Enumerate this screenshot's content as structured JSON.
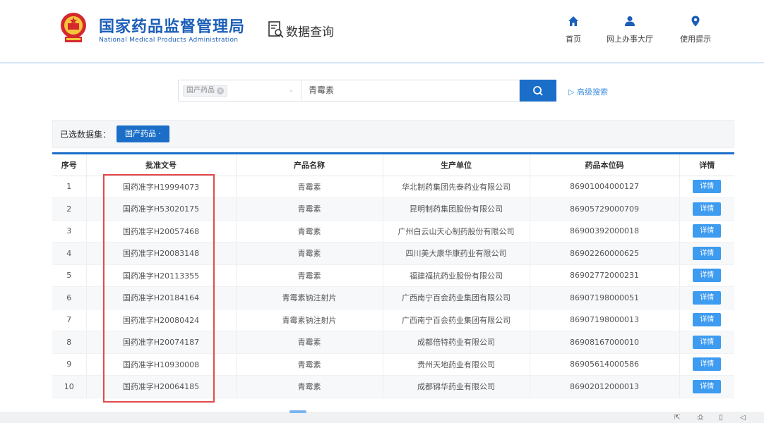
{
  "header": {
    "org_name_cn": "国家药品监督管理局",
    "org_name_en": "National Medical Products Administration",
    "page_title": "数据查询",
    "nav": [
      {
        "label": "首页",
        "icon": "home-icon"
      },
      {
        "label": "网上办事大厅",
        "icon": "user-icon"
      },
      {
        "label": "使用提示",
        "icon": "location-pin-icon"
      }
    ]
  },
  "search": {
    "category_tag": "国产药品",
    "query_value": "青霉素",
    "advanced_label": "高级搜索"
  },
  "filter": {
    "label": "已选数据集：",
    "selected_tag": "国产药品 ·"
  },
  "table": {
    "headers": [
      "序号",
      "批准文号",
      "产品名称",
      "生产单位",
      "药品本位码",
      "详情"
    ],
    "detail_label": "详情",
    "rows": [
      {
        "no": "1",
        "approval": "国药准字H19994073",
        "product": "青霉素",
        "maker": "华北制药集团先泰药业有限公司",
        "code": "86901004000127"
      },
      {
        "no": "2",
        "approval": "国药准字H53020175",
        "product": "青霉素",
        "maker": "昆明制药集团股份有限公司",
        "code": "86905729000709"
      },
      {
        "no": "3",
        "approval": "国药准字H20057468",
        "product": "青霉素",
        "maker": "广州白云山天心制药股份有限公司",
        "code": "86900392000018"
      },
      {
        "no": "4",
        "approval": "国药准字H20083148",
        "product": "青霉素",
        "maker": "四川美大康华康药业有限公司",
        "code": "86902260000625"
      },
      {
        "no": "5",
        "approval": "国药准字H20113355",
        "product": "青霉素",
        "maker": "福建福抗药业股份有限公司",
        "code": "86902772000231"
      },
      {
        "no": "6",
        "approval": "国药准字H20184164",
        "product": "青霉素钠注射片",
        "maker": "广西南宁百会药业集团有限公司",
        "code": "86907198000051"
      },
      {
        "no": "7",
        "approval": "国药准字H20080424",
        "product": "青霉素钠注射片",
        "maker": "广西南宁百会药业集团有限公司",
        "code": "86907198000013"
      },
      {
        "no": "8",
        "approval": "国药准字H20074187",
        "product": "青霉素",
        "maker": "成都倍特药业有限公司",
        "code": "86908167000010"
      },
      {
        "no": "9",
        "approval": "国药准字H10930008",
        "product": "青霉素",
        "maker": "贵州天地药业有限公司",
        "code": "86905614000586"
      },
      {
        "no": "10",
        "approval": "国药准字H20064185",
        "product": "青霉素",
        "maker": "成都锦华药业有限公司",
        "code": "86902012000013"
      }
    ]
  },
  "colors": {
    "brand_blue": "#1c5fb8",
    "button_blue": "#1a6ec8",
    "detail_blue": "#3d9bf0",
    "highlight_red": "#e24a4a"
  }
}
